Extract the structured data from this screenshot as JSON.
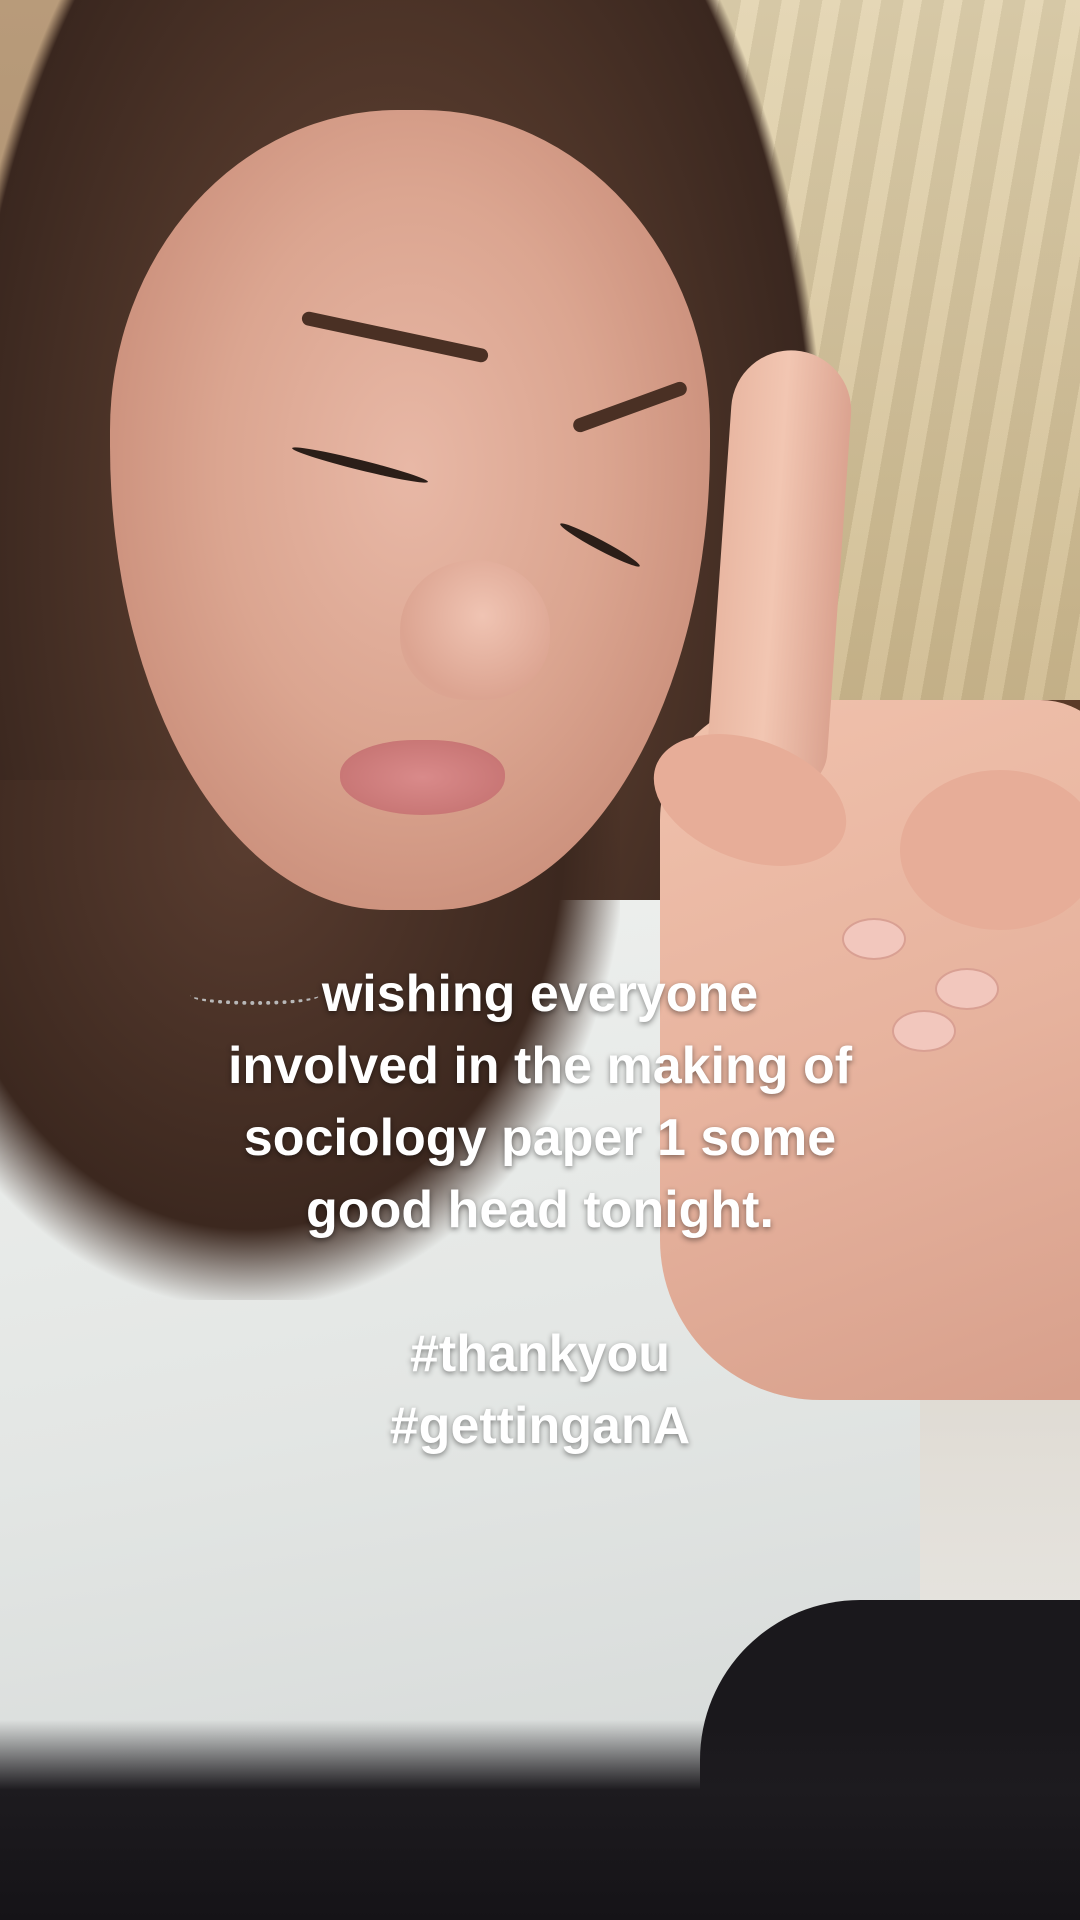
{
  "caption": {
    "lines": [
      "wishing everyone",
      "involved in the making of",
      "sociology paper 1 some",
      "good head tonight."
    ],
    "hashtags": [
      "#thankyou",
      "#gettinganA"
    ]
  }
}
